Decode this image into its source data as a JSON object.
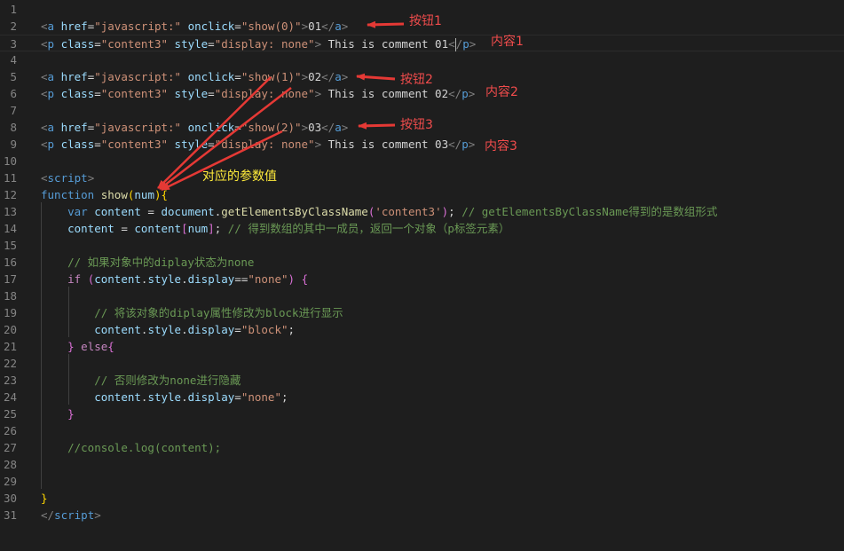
{
  "lines": [
    {
      "n": "1",
      "tokens": []
    },
    {
      "n": "2",
      "tokens": [
        {
          "t": "<",
          "c": "punct"
        },
        {
          "t": "a",
          "c": "tag"
        },
        {
          "t": " href",
          "c": "attr"
        },
        {
          "t": "=",
          "c": "text"
        },
        {
          "t": "\"javascript:\"",
          "c": "str"
        },
        {
          "t": " onclick",
          "c": "attr"
        },
        {
          "t": "=",
          "c": "text"
        },
        {
          "t": "\"show(0)\"",
          "c": "str"
        },
        {
          "t": ">",
          "c": "punct"
        },
        {
          "t": "01",
          "c": "text"
        },
        {
          "t": "</",
          "c": "punct"
        },
        {
          "t": "a",
          "c": "tag"
        },
        {
          "t": ">",
          "c": "punct"
        }
      ]
    },
    {
      "n": "3",
      "tokens": [
        {
          "t": "<",
          "c": "punct"
        },
        {
          "t": "p",
          "c": "tag"
        },
        {
          "t": " class",
          "c": "attr"
        },
        {
          "t": "=",
          "c": "text"
        },
        {
          "t": "\"content3\"",
          "c": "str"
        },
        {
          "t": " style",
          "c": "attr"
        },
        {
          "t": "=",
          "c": "text"
        },
        {
          "t": "\"display: none\"",
          "c": "str"
        },
        {
          "t": ">",
          "c": "punct"
        },
        {
          "t": " This is comment 01",
          "c": "text"
        },
        {
          "t": "<",
          "c": "punct"
        },
        {
          "t": "CARET",
          "c": "caret"
        },
        {
          "t": "/",
          "c": "punct"
        },
        {
          "t": "p",
          "c": "tag"
        },
        {
          "t": ">",
          "c": "punct"
        }
      ]
    },
    {
      "n": "4",
      "tokens": []
    },
    {
      "n": "5",
      "tokens": [
        {
          "t": "<",
          "c": "punct"
        },
        {
          "t": "a",
          "c": "tag"
        },
        {
          "t": " href",
          "c": "attr"
        },
        {
          "t": "=",
          "c": "text"
        },
        {
          "t": "\"javascript:\"",
          "c": "str"
        },
        {
          "t": " onclick",
          "c": "attr"
        },
        {
          "t": "=",
          "c": "text"
        },
        {
          "t": "\"show(1)\"",
          "c": "str"
        },
        {
          "t": ">",
          "c": "punct"
        },
        {
          "t": "02",
          "c": "text"
        },
        {
          "t": "</",
          "c": "punct"
        },
        {
          "t": "a",
          "c": "tag"
        },
        {
          "t": ">",
          "c": "punct"
        }
      ]
    },
    {
      "n": "6",
      "tokens": [
        {
          "t": "<",
          "c": "punct"
        },
        {
          "t": "p",
          "c": "tag"
        },
        {
          "t": " class",
          "c": "attr"
        },
        {
          "t": "=",
          "c": "text"
        },
        {
          "t": "\"content3\"",
          "c": "str"
        },
        {
          "t": " style",
          "c": "attr"
        },
        {
          "t": "=",
          "c": "text"
        },
        {
          "t": "\"display: none\"",
          "c": "str"
        },
        {
          "t": ">",
          "c": "punct"
        },
        {
          "t": " This is comment 02",
          "c": "text"
        },
        {
          "t": "</",
          "c": "punct"
        },
        {
          "t": "p",
          "c": "tag"
        },
        {
          "t": ">",
          "c": "punct"
        }
      ]
    },
    {
      "n": "7",
      "tokens": []
    },
    {
      "n": "8",
      "tokens": [
        {
          "t": "<",
          "c": "punct"
        },
        {
          "t": "a",
          "c": "tag"
        },
        {
          "t": " href",
          "c": "attr"
        },
        {
          "t": "=",
          "c": "text"
        },
        {
          "t": "\"javascript:\"",
          "c": "str"
        },
        {
          "t": " onclick",
          "c": "attr"
        },
        {
          "t": "=",
          "c": "text"
        },
        {
          "t": "\"show(2)\"",
          "c": "str"
        },
        {
          "t": ">",
          "c": "punct"
        },
        {
          "t": "03",
          "c": "text"
        },
        {
          "t": "</",
          "c": "punct"
        },
        {
          "t": "a",
          "c": "tag"
        },
        {
          "t": ">",
          "c": "punct"
        }
      ]
    },
    {
      "n": "9",
      "tokens": [
        {
          "t": "<",
          "c": "punct"
        },
        {
          "t": "p",
          "c": "tag"
        },
        {
          "t": " class",
          "c": "attr"
        },
        {
          "t": "=",
          "c": "text"
        },
        {
          "t": "\"content3\"",
          "c": "str"
        },
        {
          "t": " style",
          "c": "attr"
        },
        {
          "t": "=",
          "c": "text"
        },
        {
          "t": "\"display: none\"",
          "c": "str"
        },
        {
          "t": ">",
          "c": "punct"
        },
        {
          "t": " This is comment 03",
          "c": "text"
        },
        {
          "t": "</",
          "c": "punct"
        },
        {
          "t": "p",
          "c": "tag"
        },
        {
          "t": ">",
          "c": "punct"
        }
      ]
    },
    {
      "n": "10",
      "tokens": []
    },
    {
      "n": "11",
      "tokens": [
        {
          "t": "<",
          "c": "punct"
        },
        {
          "t": "script",
          "c": "tag"
        },
        {
          "t": ">",
          "c": "punct"
        }
      ]
    },
    {
      "n": "12",
      "tokens": [
        {
          "t": "function",
          "c": "kw"
        },
        {
          "t": " ",
          "c": "text"
        },
        {
          "t": "show",
          "c": "fn"
        },
        {
          "t": "(",
          "c": "brace"
        },
        {
          "t": "num",
          "c": "var"
        },
        {
          "t": ")",
          "c": "brace"
        },
        {
          "t": "{",
          "c": "brace"
        }
      ]
    },
    {
      "n": "13",
      "tokens": [
        {
          "t": "    ",
          "c": "text"
        },
        {
          "t": "var",
          "c": "kw"
        },
        {
          "t": " ",
          "c": "text"
        },
        {
          "t": "content",
          "c": "var"
        },
        {
          "t": " = ",
          "c": "text"
        },
        {
          "t": "document",
          "c": "var"
        },
        {
          "t": ".",
          "c": "text"
        },
        {
          "t": "getElementsByClassName",
          "c": "fn"
        },
        {
          "t": "(",
          "c": "brace2"
        },
        {
          "t": "'content3'",
          "c": "str"
        },
        {
          "t": ")",
          "c": "brace2"
        },
        {
          "t": "; ",
          "c": "text"
        },
        {
          "t": "// getElementsByClassName得到的是数组形式",
          "c": "cmt"
        }
      ]
    },
    {
      "n": "14",
      "tokens": [
        {
          "t": "    ",
          "c": "text"
        },
        {
          "t": "content",
          "c": "var"
        },
        {
          "t": " = ",
          "c": "text"
        },
        {
          "t": "content",
          "c": "var"
        },
        {
          "t": "[",
          "c": "brace2"
        },
        {
          "t": "num",
          "c": "var"
        },
        {
          "t": "]",
          "c": "brace2"
        },
        {
          "t": "; ",
          "c": "text"
        },
        {
          "t": "// 得到数组的其中一成员，返回一个对象（p标签元素）",
          "c": "cmt"
        }
      ]
    },
    {
      "n": "15",
      "tokens": []
    },
    {
      "n": "16",
      "tokens": [
        {
          "t": "    ",
          "c": "text"
        },
        {
          "t": "// 如果对象中的diplay状态为none",
          "c": "cmt"
        }
      ]
    },
    {
      "n": "17",
      "tokens": [
        {
          "t": "    ",
          "c": "text"
        },
        {
          "t": "if",
          "c": "ctl"
        },
        {
          "t": " ",
          "c": "text"
        },
        {
          "t": "(",
          "c": "brace2"
        },
        {
          "t": "content",
          "c": "var"
        },
        {
          "t": ".",
          "c": "text"
        },
        {
          "t": "style",
          "c": "var"
        },
        {
          "t": ".",
          "c": "text"
        },
        {
          "t": "display",
          "c": "var"
        },
        {
          "t": "==",
          "c": "text"
        },
        {
          "t": "\"none\"",
          "c": "str"
        },
        {
          "t": ")",
          "c": "brace2"
        },
        {
          "t": " ",
          "c": "text"
        },
        {
          "t": "{",
          "c": "brace2"
        }
      ]
    },
    {
      "n": "18",
      "tokens": []
    },
    {
      "n": "19",
      "tokens": [
        {
          "t": "        ",
          "c": "text"
        },
        {
          "t": "// 将该对象的diplay属性修改为block进行显示",
          "c": "cmt"
        }
      ]
    },
    {
      "n": "20",
      "tokens": [
        {
          "t": "        ",
          "c": "text"
        },
        {
          "t": "content",
          "c": "var"
        },
        {
          "t": ".",
          "c": "text"
        },
        {
          "t": "style",
          "c": "var"
        },
        {
          "t": ".",
          "c": "text"
        },
        {
          "t": "display",
          "c": "var"
        },
        {
          "t": "=",
          "c": "text"
        },
        {
          "t": "\"block\"",
          "c": "str"
        },
        {
          "t": ";",
          "c": "text"
        }
      ]
    },
    {
      "n": "21",
      "tokens": [
        {
          "t": "    ",
          "c": "text"
        },
        {
          "t": "}",
          "c": "brace2"
        },
        {
          "t": " ",
          "c": "text"
        },
        {
          "t": "else",
          "c": "ctl"
        },
        {
          "t": "{",
          "c": "brace2"
        }
      ]
    },
    {
      "n": "22",
      "tokens": []
    },
    {
      "n": "23",
      "tokens": [
        {
          "t": "        ",
          "c": "text"
        },
        {
          "t": "// 否则修改为none进行隐藏",
          "c": "cmt"
        }
      ]
    },
    {
      "n": "24",
      "tokens": [
        {
          "t": "        ",
          "c": "text"
        },
        {
          "t": "content",
          "c": "var"
        },
        {
          "t": ".",
          "c": "text"
        },
        {
          "t": "style",
          "c": "var"
        },
        {
          "t": ".",
          "c": "text"
        },
        {
          "t": "display",
          "c": "var"
        },
        {
          "t": "=",
          "c": "text"
        },
        {
          "t": "\"none\"",
          "c": "str"
        },
        {
          "t": ";",
          "c": "text"
        }
      ]
    },
    {
      "n": "25",
      "tokens": [
        {
          "t": "    ",
          "c": "text"
        },
        {
          "t": "}",
          "c": "brace2"
        }
      ]
    },
    {
      "n": "26",
      "tokens": []
    },
    {
      "n": "27",
      "tokens": [
        {
          "t": "    ",
          "c": "text"
        },
        {
          "t": "//console.log(content);",
          "c": "cmt"
        }
      ]
    },
    {
      "n": "28",
      "tokens": []
    },
    {
      "n": "29",
      "tokens": []
    },
    {
      "n": "30",
      "tokens": [
        {
          "t": "}",
          "c": "brace"
        }
      ]
    },
    {
      "n": "31",
      "tokens": [
        {
          "t": "</",
          "c": "punct"
        },
        {
          "t": "script",
          "c": "tag"
        },
        {
          "t": ">",
          "c": "punct"
        }
      ]
    }
  ],
  "annotations": {
    "button1": "按钮1",
    "button2": "按钮2",
    "button3": "按钮3",
    "content1": "内容1",
    "content2": "内容2",
    "content3": "内容3",
    "param": "对应的参数值"
  },
  "colors": {
    "background": "#1e1e1e",
    "annotation_red": "#f14c4c",
    "annotation_yellow": "#ffeb3b",
    "arrow_red": "#e53935"
  }
}
